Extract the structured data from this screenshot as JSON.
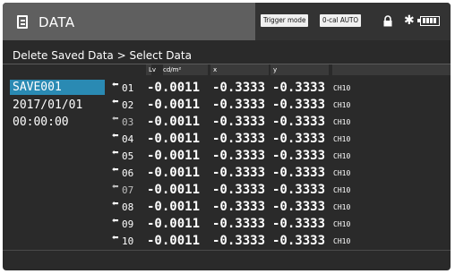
{
  "header": {
    "title": "DATA",
    "icon": "document-icon",
    "indicators": {
      "trigger_mode": "Trigger mode",
      "zero_cal": "0-cal AUTO",
      "lock_icon": "lock-icon",
      "bluetooth_icon": "bluetooth-icon",
      "battery_icon": "battery-icon"
    }
  },
  "breadcrumb": "Delete Saved Data > Select Data",
  "sidebar": {
    "save_name": "SAVE001",
    "date": "2017/01/01",
    "time": "00:00:00"
  },
  "table": {
    "columns": [
      "Lv",
      "cd/m²",
      "x",
      "y"
    ],
    "rows": [
      {
        "index": "01",
        "lv": "-0.0011",
        "x": "-0.3333",
        "y": "-0.3333",
        "ch": "CH10"
      },
      {
        "index": "02",
        "lv": "-0.0011",
        "x": "-0.3333",
        "y": "-0.3333",
        "ch": "CH10"
      },
      {
        "index": "03",
        "lv": "-0.0011",
        "x": "-0.3333",
        "y": "-0.3333",
        "ch": "CH10"
      },
      {
        "index": "04",
        "lv": "-0.0011",
        "x": "-0.3333",
        "y": "-0.3333",
        "ch": "CH10"
      },
      {
        "index": "05",
        "lv": "-0.0011",
        "x": "-0.3333",
        "y": "-0.3333",
        "ch": "CH10"
      },
      {
        "index": "06",
        "lv": "-0.0011",
        "x": "-0.3333",
        "y": "-0.3333",
        "ch": "CH10"
      },
      {
        "index": "07",
        "lv": "-0.0011",
        "x": "-0.3333",
        "y": "-0.3333",
        "ch": "CH10"
      },
      {
        "index": "08",
        "lv": "-0.0011",
        "x": "-0.3333",
        "y": "-0.3333",
        "ch": "CH10"
      },
      {
        "index": "09",
        "lv": "-0.0011",
        "x": "-0.3333",
        "y": "-0.3333",
        "ch": "CH10"
      },
      {
        "index": "10",
        "lv": "-0.0011",
        "x": "-0.3333",
        "y": "-0.3333",
        "ch": "CH10"
      }
    ]
  },
  "colors": {
    "background": "#2a2a2a",
    "header": "#5f5f5f",
    "selection": "#2a8ab3"
  }
}
